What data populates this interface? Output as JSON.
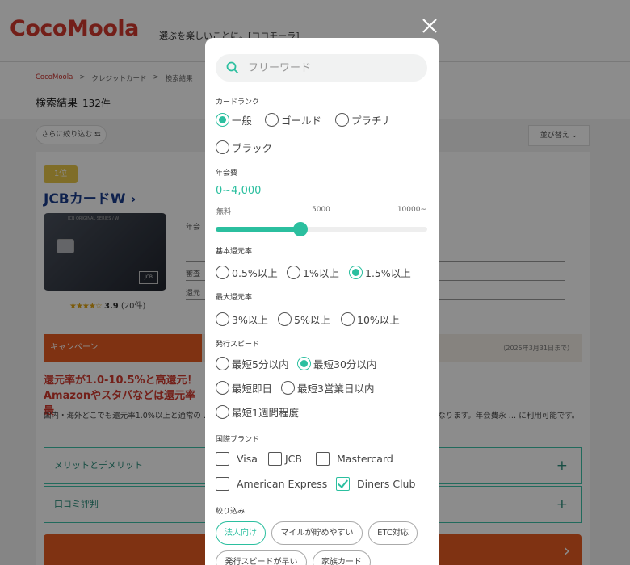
{
  "site": {
    "logo": "CocoMoola",
    "tagline": "選ぶを楽しいことに。[ココモーラ]",
    "breadcrumb": [
      "CocoMoola",
      ">",
      "クレジットカード",
      ">",
      "検索結果"
    ],
    "result_title": "検索結果",
    "result_count": "132件",
    "narrow_button": "さらに絞り込む ⇆",
    "sort_button": "並び替え ⌄"
  },
  "card": {
    "rank": "1位",
    "name": "JCBカードW ›",
    "image_series": "JCB ORIGINAL SERIES / W",
    "image_brand": "JCB",
    "rating_stars": "★★★★☆",
    "rating_score": "3.9",
    "rating_count": "(20件)",
    "row_labels": [
      "年会",
      "審査",
      "還元"
    ],
    "campaign_label": "キャンペーン",
    "campaign_deadline": "（2025年3月31日まで）",
    "headline": "還元率が1.0-10.5%と高還元！Amazonやスタバなどは還元率最",
    "description": "国内・海外どこでも還元率1.0%以上と通常の … 経由でのネットショッピングで利用すると、還元率は最大21倍になります。年会費永 … に利用可能です。",
    "accordion": [
      "メリットとデメリット",
      "口コミ評判"
    ],
    "plus": "+"
  },
  "modal": {
    "search_placeholder": "フリーワード",
    "card_rank": {
      "label": "カードランク",
      "options": [
        {
          "label": "一般",
          "selected": true
        },
        {
          "label": "ゴールド",
          "selected": false
        },
        {
          "label": "プラチナ",
          "selected": false
        },
        {
          "label": "ブラック",
          "selected": false
        }
      ]
    },
    "annual_fee": {
      "label": "年会費",
      "value": "0~4,000",
      "scale": [
        "無料",
        "5000",
        "10000~"
      ],
      "slider_fraction": 0.4
    },
    "base_rate": {
      "label": "基本還元率",
      "options": [
        {
          "label": "0.5%以上",
          "selected": false
        },
        {
          "label": "1%以上",
          "selected": false
        },
        {
          "label": "1.5%以上",
          "selected": true
        }
      ]
    },
    "max_rate": {
      "label": "最大還元率",
      "options": [
        {
          "label": "3%以上",
          "selected": false
        },
        {
          "label": "5%以上",
          "selected": false
        },
        {
          "label": "10%以上",
          "selected": false
        }
      ]
    },
    "issue_speed": {
      "label": "発行スピード",
      "options": [
        {
          "label": "最短5分以内",
          "selected": false
        },
        {
          "label": "最短30分以内",
          "selected": true
        },
        {
          "label": "最短即日",
          "selected": false
        },
        {
          "label": "最短3営業日以内",
          "selected": false
        },
        {
          "label": "最短1週間程度",
          "selected": false
        }
      ]
    },
    "brand": {
      "label": "国際ブランド",
      "options": [
        {
          "label": "Visa",
          "checked": false
        },
        {
          "label": "JCB",
          "checked": false
        },
        {
          "label": "Mastercard",
          "checked": false
        },
        {
          "label": "American Express",
          "checked": false
        },
        {
          "label": "Diners Club",
          "checked": true
        }
      ]
    },
    "narrow": {
      "label": "絞り込み",
      "chips": [
        {
          "label": "法人向け",
          "selected": true
        },
        {
          "label": "マイルが貯めやすい",
          "selected": false
        },
        {
          "label": "ETC対応",
          "selected": false
        },
        {
          "label": "発行スピードが早い",
          "selected": false
        },
        {
          "label": "家族カード",
          "selected": false
        }
      ]
    }
  },
  "colors": {
    "accent": "#2bbf9f",
    "brand_red": "#d23a2e",
    "campaign_orange": "#e85c22"
  }
}
